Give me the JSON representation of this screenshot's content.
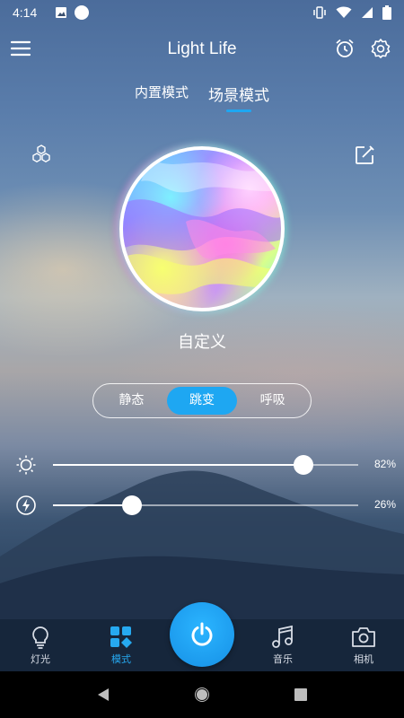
{
  "status_bar": {
    "time": "4:14"
  },
  "app_bar": {
    "title": "Light Life"
  },
  "mode_tabs": [
    {
      "label": "内置模式",
      "active": false
    },
    {
      "label": "场景模式",
      "active": true
    }
  ],
  "scene": {
    "name": "自定义"
  },
  "effect_modes": [
    {
      "label": "静态",
      "active": false
    },
    {
      "label": "跳变",
      "active": true
    },
    {
      "label": "呼吸",
      "active": false
    }
  ],
  "sliders": {
    "brightness": {
      "value": 82,
      "label": "82%"
    },
    "speed": {
      "value": 26,
      "label": "26%"
    }
  },
  "bottom_nav": [
    {
      "label": "灯光",
      "icon": "bulb-icon",
      "active": false
    },
    {
      "label": "模式",
      "icon": "mode-grid-icon",
      "active": true
    },
    {
      "label": "音乐",
      "icon": "music-note-icon",
      "active": false
    },
    {
      "label": "相机",
      "icon": "camera-icon",
      "active": false
    }
  ],
  "colors": {
    "accent": "#1ea7f2",
    "nav_bg": "#16263b"
  }
}
